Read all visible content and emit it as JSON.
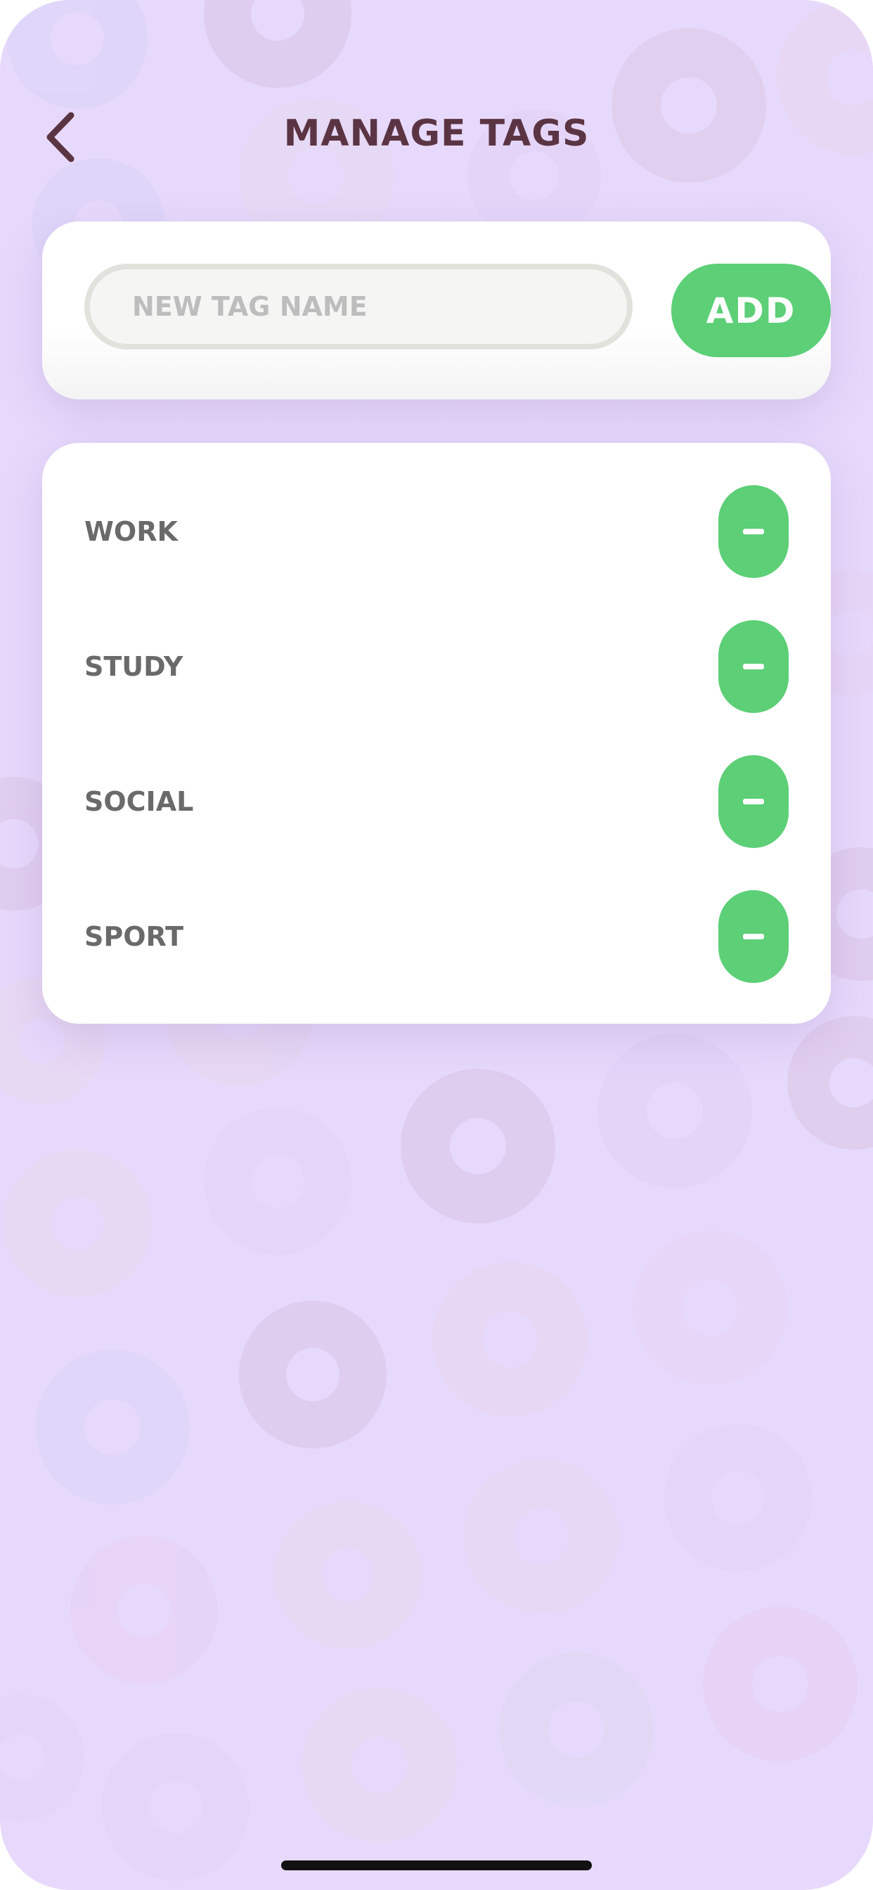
{
  "colors": {
    "background": "#e7d9fb",
    "title": "#5b3443",
    "accent_green": "#5ccf77",
    "card": "#ffffff",
    "tag_text": "#6a6a6a",
    "placeholder": "#bdbdbd"
  },
  "header": {
    "back_icon": "chevron-left-icon",
    "title": "MANAGE TAGS"
  },
  "add_tag": {
    "input_value": "",
    "placeholder": "NEW TAG NAME",
    "button_label": "ADD"
  },
  "tags": [
    {
      "label": "WORK",
      "action_icon": "minus-icon"
    },
    {
      "label": "STUDY",
      "action_icon": "minus-icon"
    },
    {
      "label": "SOCIAL",
      "action_icon": "minus-icon"
    },
    {
      "label": "SPORT",
      "action_icon": "minus-icon"
    }
  ],
  "background_pattern_icon": "donut-icon"
}
